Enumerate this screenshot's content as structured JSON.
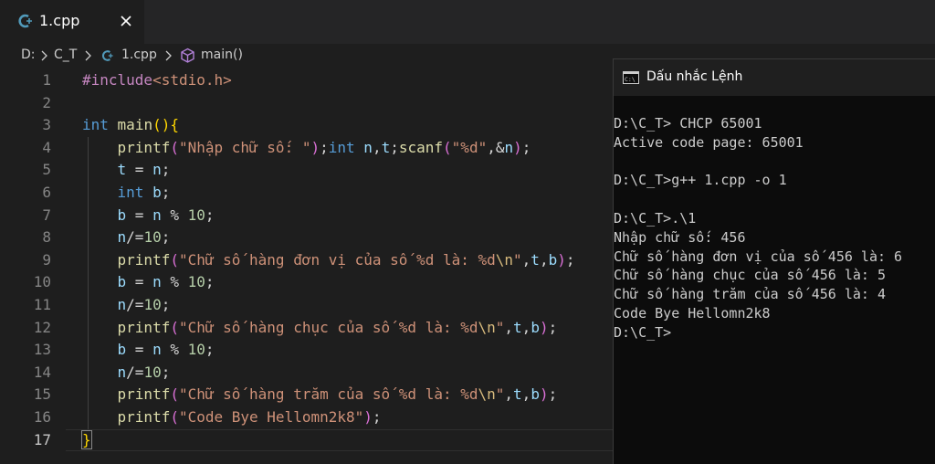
{
  "tab": {
    "title": "1.cpp",
    "close_label": "✕"
  },
  "breadcrumb": {
    "items": [
      {
        "label": "D:"
      },
      {
        "label": "C_T"
      },
      {
        "label": "1.cpp"
      },
      {
        "label": "main()"
      }
    ]
  },
  "editor": {
    "active_line": 17,
    "lines": [
      {
        "n": "1",
        "tokens": [
          [
            "pp",
            "#include"
          ],
          [
            "str",
            "<stdio.h>"
          ]
        ]
      },
      {
        "n": "2",
        "tokens": []
      },
      {
        "n": "3",
        "tokens": [
          [
            "kw",
            "int"
          ],
          [
            "op",
            " "
          ],
          [
            "fn",
            "main"
          ],
          [
            "br",
            "()"
          ],
          [
            "br",
            "{"
          ]
        ]
      },
      {
        "n": "4",
        "tokens": [
          [
            "op",
            "    "
          ],
          [
            "fn",
            "printf"
          ],
          [
            "br2",
            "("
          ],
          [
            "str",
            "\"Nhập chữ số: \""
          ],
          [
            "br2",
            ")"
          ],
          [
            "op",
            ";"
          ],
          [
            "kw",
            "int"
          ],
          [
            "op",
            " "
          ],
          [
            "var",
            "n"
          ],
          [
            "op",
            ","
          ],
          [
            "var",
            "t"
          ],
          [
            "op",
            ";"
          ],
          [
            "fn",
            "scanf"
          ],
          [
            "br2",
            "("
          ],
          [
            "str",
            "\"%d\""
          ],
          [
            "op",
            ",&"
          ],
          [
            "var",
            "n"
          ],
          [
            "br2",
            ")"
          ],
          [
            "op",
            ";"
          ]
        ]
      },
      {
        "n": "5",
        "tokens": [
          [
            "op",
            "    "
          ],
          [
            "var",
            "t"
          ],
          [
            "op",
            " = "
          ],
          [
            "var",
            "n"
          ],
          [
            "op",
            ";"
          ]
        ]
      },
      {
        "n": "6",
        "tokens": [
          [
            "op",
            "    "
          ],
          [
            "kw",
            "int"
          ],
          [
            "op",
            " "
          ],
          [
            "var",
            "b"
          ],
          [
            "op",
            ";"
          ]
        ]
      },
      {
        "n": "7",
        "tokens": [
          [
            "op",
            "    "
          ],
          [
            "var",
            "b"
          ],
          [
            "op",
            " = "
          ],
          [
            "var",
            "n"
          ],
          [
            "op",
            " % "
          ],
          [
            "num",
            "10"
          ],
          [
            "op",
            ";"
          ]
        ]
      },
      {
        "n": "8",
        "tokens": [
          [
            "op",
            "    "
          ],
          [
            "var",
            "n"
          ],
          [
            "op",
            "/="
          ],
          [
            "num",
            "10"
          ],
          [
            "op",
            ";"
          ]
        ]
      },
      {
        "n": "9",
        "tokens": [
          [
            "op",
            "    "
          ],
          [
            "fn",
            "printf"
          ],
          [
            "br2",
            "("
          ],
          [
            "str",
            "\"Chữ số hàng đơn vị của số %d là: %d"
          ],
          [
            "esc",
            "\\n"
          ],
          [
            "str",
            "\""
          ],
          [
            "op",
            ","
          ],
          [
            "var",
            "t"
          ],
          [
            "op",
            ","
          ],
          [
            "var",
            "b"
          ],
          [
            "br2",
            ")"
          ],
          [
            "op",
            ";"
          ]
        ]
      },
      {
        "n": "10",
        "tokens": [
          [
            "op",
            "    "
          ],
          [
            "var",
            "b"
          ],
          [
            "op",
            " = "
          ],
          [
            "var",
            "n"
          ],
          [
            "op",
            " % "
          ],
          [
            "num",
            "10"
          ],
          [
            "op",
            ";"
          ]
        ]
      },
      {
        "n": "11",
        "tokens": [
          [
            "op",
            "    "
          ],
          [
            "var",
            "n"
          ],
          [
            "op",
            "/="
          ],
          [
            "num",
            "10"
          ],
          [
            "op",
            ";"
          ]
        ]
      },
      {
        "n": "12",
        "tokens": [
          [
            "op",
            "    "
          ],
          [
            "fn",
            "printf"
          ],
          [
            "br2",
            "("
          ],
          [
            "str",
            "\"Chữ số hàng chục của số %d là: %d"
          ],
          [
            "esc",
            "\\n"
          ],
          [
            "str",
            "\""
          ],
          [
            "op",
            ","
          ],
          [
            "var",
            "t"
          ],
          [
            "op",
            ","
          ],
          [
            "var",
            "b"
          ],
          [
            "br2",
            ")"
          ],
          [
            "op",
            ";"
          ]
        ]
      },
      {
        "n": "13",
        "tokens": [
          [
            "op",
            "    "
          ],
          [
            "var",
            "b"
          ],
          [
            "op",
            " = "
          ],
          [
            "var",
            "n"
          ],
          [
            "op",
            " % "
          ],
          [
            "num",
            "10"
          ],
          [
            "op",
            ";"
          ]
        ]
      },
      {
        "n": "14",
        "tokens": [
          [
            "op",
            "    "
          ],
          [
            "var",
            "n"
          ],
          [
            "op",
            "/="
          ],
          [
            "num",
            "10"
          ],
          [
            "op",
            ";"
          ]
        ]
      },
      {
        "n": "15",
        "tokens": [
          [
            "op",
            "    "
          ],
          [
            "fn",
            "printf"
          ],
          [
            "br2",
            "("
          ],
          [
            "str",
            "\"Chữ số hàng trăm của số %d là: %d"
          ],
          [
            "esc",
            "\\n"
          ],
          [
            "str",
            "\""
          ],
          [
            "op",
            ","
          ],
          [
            "var",
            "t"
          ],
          [
            "op",
            ","
          ],
          [
            "var",
            "b"
          ],
          [
            "br2",
            ")"
          ],
          [
            "op",
            ";"
          ]
        ]
      },
      {
        "n": "16",
        "tokens": [
          [
            "op",
            "    "
          ],
          [
            "fn",
            "printf"
          ],
          [
            "br2",
            "("
          ],
          [
            "str",
            "\"Code Bye Hellomn2k8\""
          ],
          [
            "br2",
            ")"
          ],
          [
            "op",
            ";"
          ]
        ]
      },
      {
        "n": "17",
        "tokens": [
          [
            "br",
            "}"
          ]
        ]
      }
    ]
  },
  "cmd": {
    "title": "Dấu nhắc Lệnh",
    "lines": [
      "D:\\C_T> CHCP 65001",
      "Active code page: 65001",
      "",
      "D:\\C_T>g++ 1.cpp -o 1",
      "",
      "D:\\C_T>.\\1",
      "Nhập chữ số: 456",
      "Chữ số hàng đơn vị của số 456 là: 6",
      "Chữ số hàng chục của số 456 là: 5",
      "Chữ số hàng trăm của số 456 là: 4",
      "Code Bye Hellomn2k8",
      "D:\\C_T>"
    ]
  },
  "colors": {
    "editor_bg": "#1e1e1e",
    "tab_bar_bg": "#252526",
    "keyword": "#569cd6",
    "function": "#dcdcaa",
    "string": "#ce9178",
    "number": "#b5cea8",
    "variable": "#9cdcfe",
    "preprocessor": "#c586c0",
    "terminal_bg": "#0c0c0c",
    "terminal_text": "#cccccc"
  },
  "icons": {
    "file_icon": "cpp-file-icon",
    "close": "close-icon",
    "chevron": "chevron-right-icon",
    "symbol": "cube-method-icon",
    "terminal": "cmd-window-icon"
  }
}
